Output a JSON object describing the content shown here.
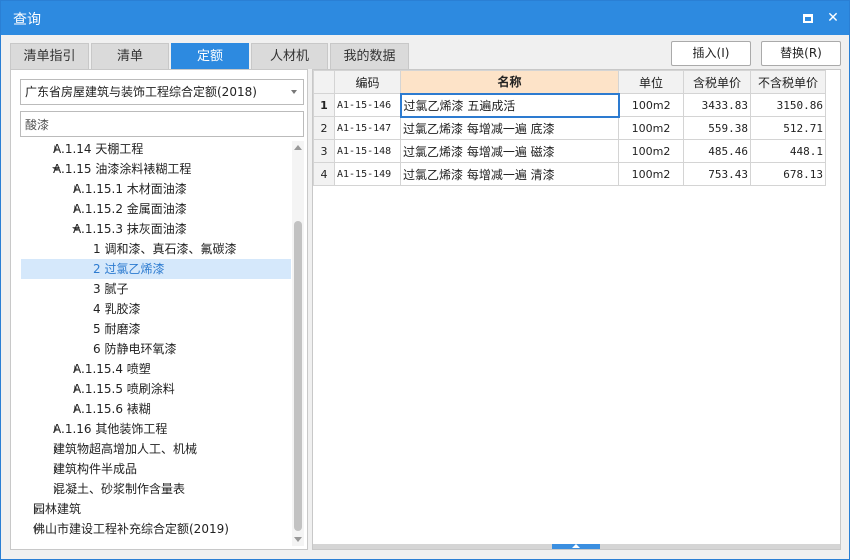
{
  "window": {
    "title": "查询",
    "maximize_icon": "maximize-icon",
    "close_icon": "close-icon",
    "close_glyph": "✕"
  },
  "tabs": [
    {
      "label": "清单指引",
      "active": false
    },
    {
      "label": "清单",
      "active": false
    },
    {
      "label": "定额",
      "active": true
    },
    {
      "label": "人材机",
      "active": false
    },
    {
      "label": "我的数据",
      "active": false
    }
  ],
  "toolbar": {
    "insert_label": "插入(I)",
    "replace_label": "替换(R)"
  },
  "left": {
    "quota_select": "广东省房屋建筑与装饰工程综合定额(2018)",
    "search_value": "酸漆",
    "tree": [
      {
        "label": "A.1.14 天棚工程",
        "depth": 1,
        "state": "collapsed"
      },
      {
        "label": "A.1.15 油漆涂料裱糊工程",
        "depth": 1,
        "state": "expanded"
      },
      {
        "label": "A.1.15.1 木材面油漆",
        "depth": 2,
        "state": "collapsed"
      },
      {
        "label": "A.1.15.2 金属面油漆",
        "depth": 2,
        "state": "collapsed"
      },
      {
        "label": "A.1.15.3 抹灰面油漆",
        "depth": 2,
        "state": "expanded"
      },
      {
        "label": "1 调和漆、真石漆、氟碳漆",
        "depth": 3,
        "state": "leaf"
      },
      {
        "label": "2 过氯乙烯漆",
        "depth": 3,
        "state": "leaf",
        "selected": true
      },
      {
        "label": "3 腻子",
        "depth": 3,
        "state": "leaf"
      },
      {
        "label": "4 乳胶漆",
        "depth": 3,
        "state": "leaf"
      },
      {
        "label": "5 耐磨漆",
        "depth": 3,
        "state": "leaf"
      },
      {
        "label": "6 防静电环氧漆",
        "depth": 3,
        "state": "leaf"
      },
      {
        "label": "A.1.15.4 喷塑",
        "depth": 2,
        "state": "collapsed"
      },
      {
        "label": "A.1.15.5 喷刷涂料",
        "depth": 2,
        "state": "collapsed"
      },
      {
        "label": "A.1.15.6 裱糊",
        "depth": 2,
        "state": "collapsed"
      },
      {
        "label": "A.1.16 其他装饰工程",
        "depth": 1,
        "state": "collapsed"
      },
      {
        "label": "建筑物超高增加人工、机械",
        "depth": 1,
        "state": "collapsed"
      },
      {
        "label": "建筑构件半成品",
        "depth": 1,
        "state": "collapsed"
      },
      {
        "label": "混凝土、砂浆制作含量表",
        "depth": 1,
        "state": "collapsed"
      },
      {
        "label": "园林建筑",
        "depth": 0,
        "state": "collapsed"
      },
      {
        "label": "佛山市建设工程补充综合定额(2019)",
        "depth": 0,
        "state": "collapsed"
      }
    ]
  },
  "table": {
    "headers": {
      "code": "编码",
      "name": "名称",
      "unit": "单位",
      "tax_price": "含税单价",
      "notax_price": "不含税单价"
    },
    "rows": [
      {
        "idx": "1",
        "code": "A1-15-146",
        "name": "过氯乙烯漆 五遍成活",
        "unit": "100m2",
        "tax_price": "3433.83",
        "notax_price": "3150.86",
        "current": true
      },
      {
        "idx": "2",
        "code": "A1-15-147",
        "name": "过氯乙烯漆 每增减一遍 底漆",
        "unit": "100m2",
        "tax_price": "559.38",
        "notax_price": "512.71"
      },
      {
        "idx": "3",
        "code": "A1-15-148",
        "name": "过氯乙烯漆 每增减一遍 磁漆",
        "unit": "100m2",
        "tax_price": "485.46",
        "notax_price": "448.1"
      },
      {
        "idx": "4",
        "code": "A1-15-149",
        "name": "过氯乙烯漆 每增减一遍 清漆",
        "unit": "100m2",
        "tax_price": "753.43",
        "notax_price": "678.13"
      }
    ]
  },
  "colors": {
    "accent": "#2d8ae0",
    "selected_bg": "#d5e8fb",
    "header_highlight": "#fde3c8"
  }
}
